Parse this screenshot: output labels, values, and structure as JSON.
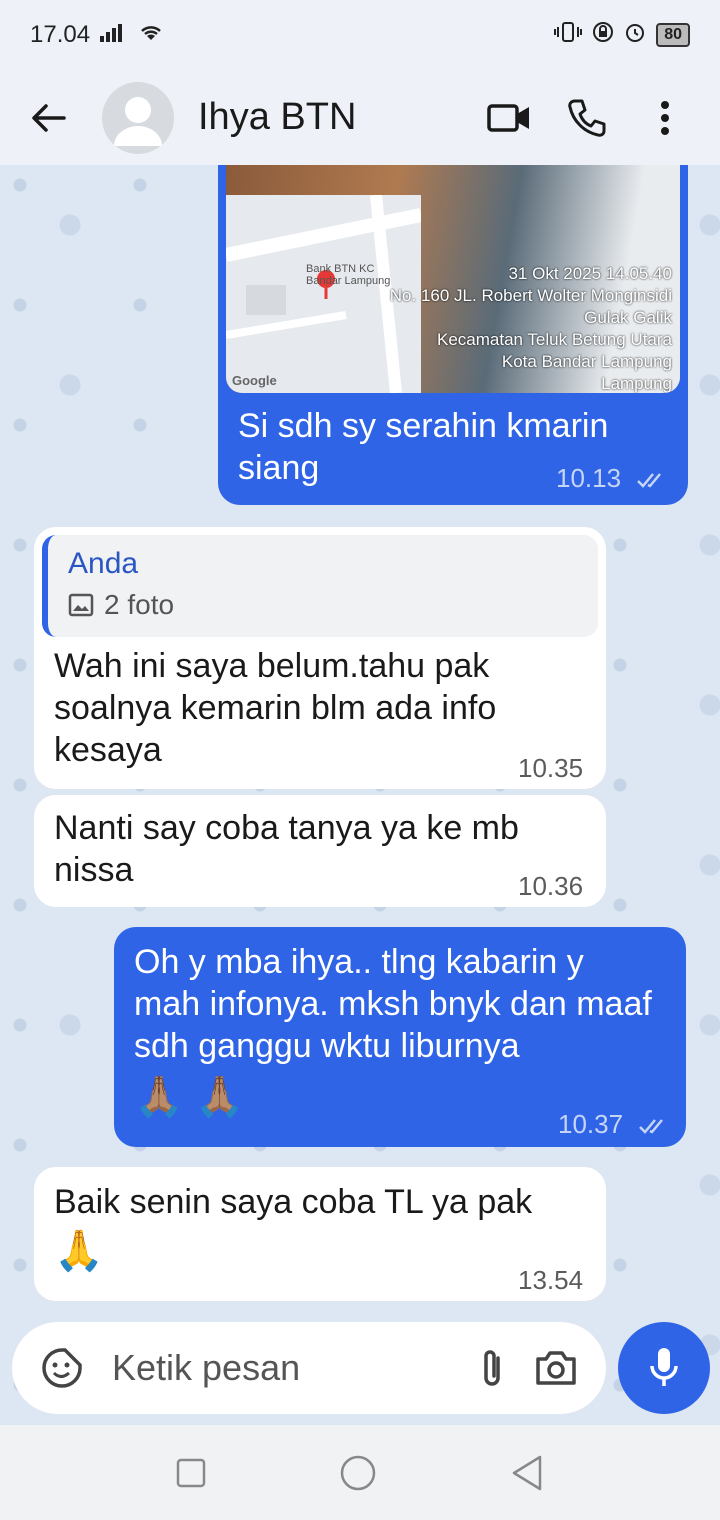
{
  "status": {
    "time": "17.04",
    "battery": "80"
  },
  "header": {
    "contact_name": "Ihya BTN"
  },
  "messages": [
    {
      "id": "m1",
      "dir": "out",
      "image": {
        "map_label": "Bank BTN KC Bandar Lampung",
        "timestamp": "31 Okt 2025 14.05.40",
        "address1": "No. 160 JL. Robert Wolter Monginsidi",
        "address2": "Gulak Galik",
        "address3": "Kecamatan Teluk Betung Utara",
        "address4": "Kota Bandar Lampung",
        "address5": "Lampung",
        "map_brand": "Google"
      },
      "text": "Si sdh sy serahin kmarin siang",
      "time": "10.13"
    },
    {
      "id": "m2",
      "dir": "in",
      "quote": {
        "name": "Anda",
        "sub": "2 foto"
      },
      "text": "Wah ini saya belum.tahu pak soalnya kemarin blm ada info kesaya",
      "time": "10.35"
    },
    {
      "id": "m3",
      "dir": "in",
      "text": "Nanti say coba tanya ya ke mb nissa",
      "time": "10.36"
    },
    {
      "id": "m4",
      "dir": "out",
      "text": "Oh y mba ihya.. tlng kabarin y mah infonya. mksh bnyk dan maaf sdh ganggu wktu liburnya",
      "emoji": "🙏🏽 🙏🏽",
      "time": "10.37"
    },
    {
      "id": "m5",
      "dir": "in",
      "text": "Baik senin saya coba TL ya pak",
      "emoji": "🙏",
      "time": "13.54"
    }
  ],
  "composer": {
    "placeholder": "Ketik pesan"
  },
  "colors": {
    "accent": "#2f64e6",
    "incoming": "#ffffff",
    "chat_bg": "#dde7f3"
  },
  "icons": [
    "back-arrow-icon",
    "avatar-icon",
    "video-call-icon",
    "phone-icon",
    "more-vert-icon",
    "sticker-icon",
    "attach-icon",
    "camera-icon",
    "mic-icon",
    "read-ticks-icon",
    "image-icon"
  ]
}
